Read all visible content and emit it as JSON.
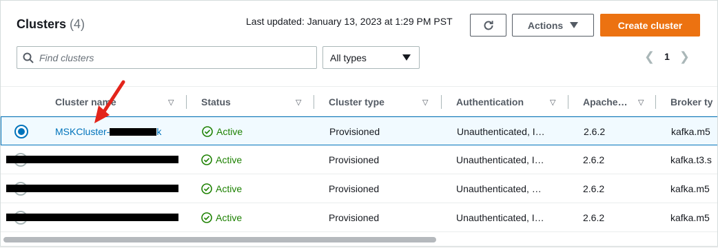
{
  "header": {
    "title": "Clusters",
    "count": "(4)",
    "last_updated": "Last updated: January 13, 2023 at 1:29 PM PST",
    "actions_label": "Actions",
    "create_label": "Create cluster"
  },
  "filter": {
    "search_placeholder": "Find clusters",
    "type_selected": "All types"
  },
  "pagination": {
    "current_page": "1"
  },
  "columns": [
    "Cluster name",
    "Status",
    "Cluster type",
    "Authentication",
    "Apache…",
    "Broker ty"
  ],
  "rows": [
    {
      "name": "MSKCluster-",
      "name_suffix": "k",
      "status": "Active",
      "type": "Provisioned",
      "auth": "Unauthenticated, I…",
      "version": "2.6.2",
      "broker": "kafka.m5"
    },
    {
      "name": "",
      "status": "Active",
      "type": "Provisioned",
      "auth": "Unauthenticated, I…",
      "version": "2.6.2",
      "broker": "kafka.t3.s"
    },
    {
      "name": "",
      "status": "Active",
      "type": "Provisioned",
      "auth": "Unauthenticated, …",
      "version": "2.6.2",
      "broker": "kafka.m5"
    },
    {
      "name": "",
      "status": "Active",
      "type": "Provisioned",
      "auth": "Unauthenticated, I…",
      "version": "2.6.2",
      "broker": "kafka.m5"
    }
  ],
  "icons": {
    "refresh": "refresh-icon",
    "actions": "caret-down-icon",
    "search": "search-icon",
    "select": "caret-down-icon",
    "status": "check-circle-icon",
    "prev": "chevron-left-icon",
    "next": "chevron-right-icon"
  },
  "colors": {
    "accent": "#ec7211",
    "link": "#0073bb",
    "success": "#1d8102",
    "annotation": "#e3241b"
  }
}
